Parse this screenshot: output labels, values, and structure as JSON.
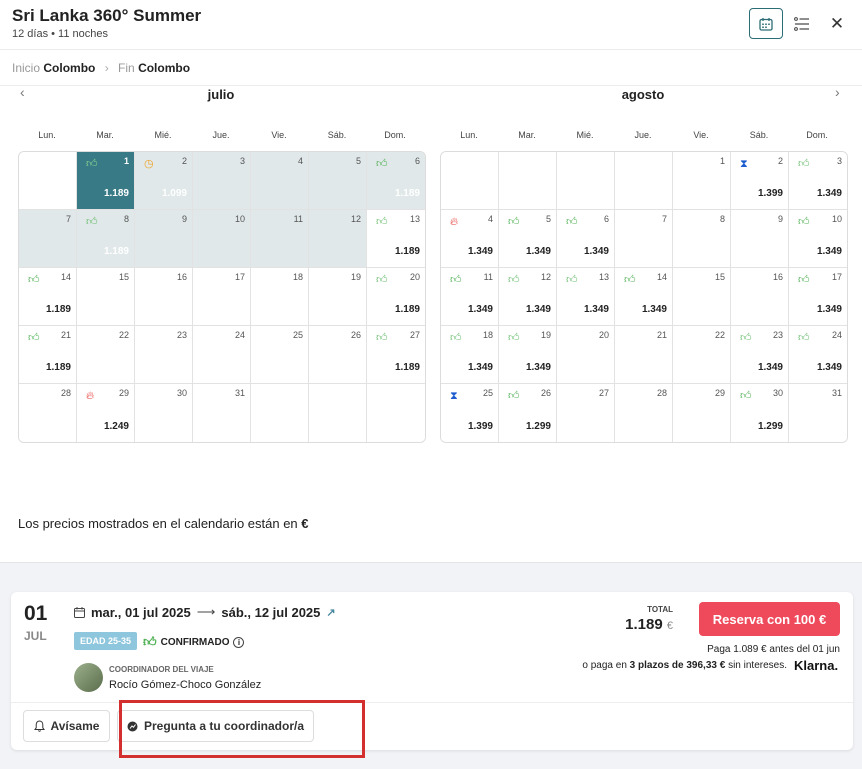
{
  "header": {
    "title": "Sri Lanka 360° Summer",
    "subtitle": "12 días • 11 noches",
    "calendar_icon": "calendar-icon",
    "list_icon": "list-icon",
    "close_icon": "close-icon"
  },
  "breadcrumb": {
    "start_label": "Inicio",
    "start_city": "Colombo",
    "end_label": "Fin",
    "end_city": "Colombo"
  },
  "calendar": {
    "weekdays": [
      "Lun.",
      "Mar.",
      "Mié.",
      "Jue.",
      "Vie.",
      "Sáb.",
      "Dom."
    ],
    "months": [
      {
        "name": "julio",
        "cells": [
          {
            "d": "",
            "p": "",
            "i": "",
            "s": ""
          },
          {
            "d": "1",
            "p": "1.189",
            "i": "thumb",
            "s": "start"
          },
          {
            "d": "2",
            "p": "1.099",
            "i": "clock",
            "s": "range",
            "light": true
          },
          {
            "d": "3",
            "p": "",
            "i": "",
            "s": "range"
          },
          {
            "d": "4",
            "p": "",
            "i": "",
            "s": "range"
          },
          {
            "d": "5",
            "p": "",
            "i": "",
            "s": "range"
          },
          {
            "d": "6",
            "p": "1.189",
            "i": "thumb",
            "s": "range",
            "light": true
          },
          {
            "d": "7",
            "p": "",
            "i": "",
            "s": "range"
          },
          {
            "d": "8",
            "p": "1.189",
            "i": "thumbo",
            "s": "range",
            "light": true
          },
          {
            "d": "9",
            "p": "",
            "i": "",
            "s": "range"
          },
          {
            "d": "10",
            "p": "",
            "i": "",
            "s": "range"
          },
          {
            "d": "11",
            "p": "",
            "i": "",
            "s": "range"
          },
          {
            "d": "12",
            "p": "",
            "i": "",
            "s": "range"
          },
          {
            "d": "13",
            "p": "1.189",
            "i": "thumbo",
            "s": ""
          },
          {
            "d": "14",
            "p": "1.189",
            "i": "thumb",
            "s": ""
          },
          {
            "d": "15",
            "p": "",
            "i": "",
            "s": ""
          },
          {
            "d": "16",
            "p": "",
            "i": "",
            "s": ""
          },
          {
            "d": "17",
            "p": "",
            "i": "",
            "s": ""
          },
          {
            "d": "18",
            "p": "",
            "i": "",
            "s": ""
          },
          {
            "d": "19",
            "p": "",
            "i": "",
            "s": ""
          },
          {
            "d": "20",
            "p": "1.189",
            "i": "thumbo",
            "s": ""
          },
          {
            "d": "21",
            "p": "1.189",
            "i": "thumb",
            "s": ""
          },
          {
            "d": "22",
            "p": "",
            "i": "",
            "s": ""
          },
          {
            "d": "23",
            "p": "",
            "i": "",
            "s": ""
          },
          {
            "d": "24",
            "p": "",
            "i": "",
            "s": ""
          },
          {
            "d": "25",
            "p": "",
            "i": "",
            "s": ""
          },
          {
            "d": "26",
            "p": "",
            "i": "",
            "s": ""
          },
          {
            "d": "27",
            "p": "1.189",
            "i": "thumbo",
            "s": ""
          },
          {
            "d": "28",
            "p": "",
            "i": "",
            "s": ""
          },
          {
            "d": "29",
            "p": "1.249",
            "i": "fire",
            "s": ""
          },
          {
            "d": "30",
            "p": "",
            "i": "",
            "s": ""
          },
          {
            "d": "31",
            "p": "",
            "i": "",
            "s": ""
          },
          {
            "d": "",
            "p": "",
            "i": "",
            "s": ""
          },
          {
            "d": "",
            "p": "",
            "i": "",
            "s": ""
          },
          {
            "d": "",
            "p": "",
            "i": "",
            "s": ""
          }
        ]
      },
      {
        "name": "agosto",
        "cells": [
          {
            "d": "",
            "p": "",
            "i": "",
            "s": ""
          },
          {
            "d": "",
            "p": "",
            "i": "",
            "s": ""
          },
          {
            "d": "",
            "p": "",
            "i": "",
            "s": ""
          },
          {
            "d": "",
            "p": "",
            "i": "",
            "s": ""
          },
          {
            "d": "1",
            "p": "",
            "i": "",
            "s": ""
          },
          {
            "d": "2",
            "p": "1.399",
            "i": "hour",
            "s": ""
          },
          {
            "d": "3",
            "p": "1.349",
            "i": "thumbo",
            "s": ""
          },
          {
            "d": "4",
            "p": "1.349",
            "i": "fire",
            "s": ""
          },
          {
            "d": "5",
            "p": "1.349",
            "i": "thumb",
            "s": ""
          },
          {
            "d": "6",
            "p": "1.349",
            "i": "thumb",
            "s": ""
          },
          {
            "d": "7",
            "p": "",
            "i": "",
            "s": ""
          },
          {
            "d": "8",
            "p": "",
            "i": "",
            "s": ""
          },
          {
            "d": "9",
            "p": "",
            "i": "",
            "s": ""
          },
          {
            "d": "10",
            "p": "1.349",
            "i": "thumb",
            "s": ""
          },
          {
            "d": "11",
            "p": "1.349",
            "i": "thumb",
            "s": ""
          },
          {
            "d": "12",
            "p": "1.349",
            "i": "thumbo",
            "s": ""
          },
          {
            "d": "13",
            "p": "1.349",
            "i": "thumbo",
            "s": ""
          },
          {
            "d": "14",
            "p": "1.349",
            "i": "thumb",
            "s": ""
          },
          {
            "d": "15",
            "p": "",
            "i": "",
            "s": ""
          },
          {
            "d": "16",
            "p": "",
            "i": "",
            "s": ""
          },
          {
            "d": "17",
            "p": "1.349",
            "i": "thumb",
            "s": ""
          },
          {
            "d": "18",
            "p": "1.349",
            "i": "thumbo",
            "s": ""
          },
          {
            "d": "19",
            "p": "1.349",
            "i": "thumbo",
            "s": ""
          },
          {
            "d": "20",
            "p": "",
            "i": "",
            "s": ""
          },
          {
            "d": "21",
            "p": "",
            "i": "",
            "s": ""
          },
          {
            "d": "22",
            "p": "",
            "i": "",
            "s": ""
          },
          {
            "d": "23",
            "p": "1.349",
            "i": "thumbo",
            "s": ""
          },
          {
            "d": "24",
            "p": "1.349",
            "i": "thumbo",
            "s": ""
          },
          {
            "d": "25",
            "p": "1.399",
            "i": "hour",
            "s": ""
          },
          {
            "d": "26",
            "p": "1.299",
            "i": "thumb",
            "s": ""
          },
          {
            "d": "27",
            "p": "",
            "i": "",
            "s": ""
          },
          {
            "d": "28",
            "p": "",
            "i": "",
            "s": ""
          },
          {
            "d": "29",
            "p": "",
            "i": "",
            "s": ""
          },
          {
            "d": "30",
            "p": "1.299",
            "i": "thumb",
            "s": ""
          },
          {
            "d": "31",
            "p": "",
            "i": "",
            "s": ""
          }
        ]
      }
    ],
    "note_text": "Los precios mostrados en el calendario están en",
    "note_currency": "€"
  },
  "departure": {
    "day": "01",
    "month": "JUL",
    "date_start": "mar., 01 jul 2025",
    "date_end": "sáb., 12 jul 2025",
    "age_badge": "EDAD 25-35",
    "status": "CONFIRMADO",
    "coordinator_label": "COORDINADOR DEL VIAJE",
    "coordinator_name": "Rocío Gómez-Choco González",
    "total_label": "TOTAL",
    "total_value": "1.189",
    "total_currency": "€",
    "reserve_button": "Reserva con 100 €",
    "pay_now": "Paga 1.089 € antes del 01 jun",
    "pay_installments_pre": "o paga en",
    "pay_installments_bold": "3 plazos de 396,33 €",
    "pay_installments_post": "sin intereses.",
    "klarna_logo": "Klarna.",
    "notify_button": "Avísame",
    "ask_button": "Pregunta a tu coordinador/a"
  },
  "colors": {
    "accent": "#387b86",
    "range": "#e0e8e9",
    "reserve": "#ef4a5c",
    "highlight": "#d32f2f"
  }
}
